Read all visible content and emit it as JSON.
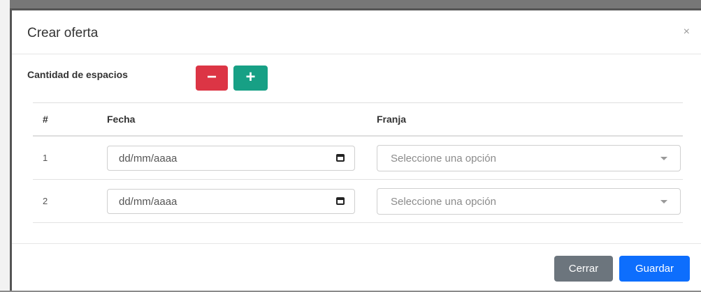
{
  "modal": {
    "title": "Crear oferta",
    "close": "×"
  },
  "quantity": {
    "label": "Cantidad de espacios",
    "minus": "−",
    "plus": "+"
  },
  "table": {
    "headers": [
      "#",
      "Fecha",
      "Franja"
    ],
    "rows": [
      {
        "num": "1",
        "date_placeholder": "dd/mm/aaaa",
        "select_placeholder": "Seleccione una opción"
      },
      {
        "num": "2",
        "date_placeholder": "dd/mm/aaaa",
        "select_placeholder": "Seleccione una opción"
      }
    ]
  },
  "footer": {
    "close_label": "Cerrar",
    "save_label": "Guardar"
  },
  "colors": {
    "danger": "#dc3545",
    "success": "#17a085",
    "secondary": "#6c757d",
    "primary": "#0d6efd"
  }
}
